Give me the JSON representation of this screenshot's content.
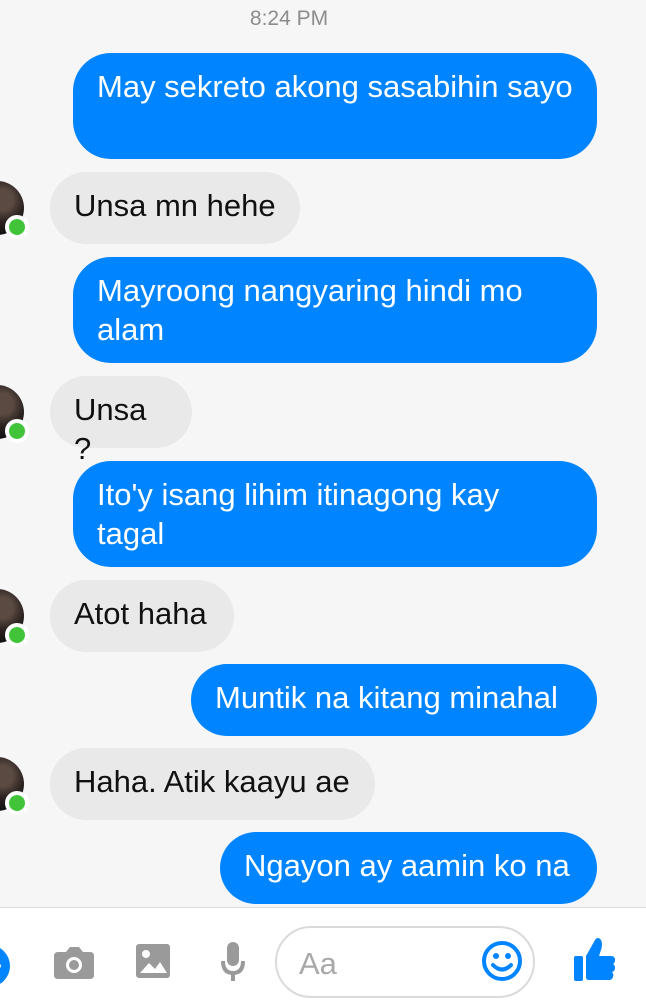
{
  "conversation": {
    "timestamp": "8:24 PM",
    "messages": [
      {
        "sender": "me",
        "text": "May sekreto akong sasabihin sayo"
      },
      {
        "sender": "contact",
        "text": "Unsa mn hehe"
      },
      {
        "sender": "me",
        "text": "Mayroong nangyaring hindi mo alam"
      },
      {
        "sender": "contact",
        "text": "Unsa ?"
      },
      {
        "sender": "me",
        "text": "Ito'y isang lihim itinagong kay tagal"
      },
      {
        "sender": "contact",
        "text": "Atot haha"
      },
      {
        "sender": "me",
        "text": "Muntik na kitang minahal"
      },
      {
        "sender": "contact",
        "text": "Haha. Atik kaayu ae"
      },
      {
        "sender": "me",
        "text": "Ngayon ay aamin ko na"
      }
    ]
  },
  "composer": {
    "placeholder": "Aa",
    "icons": [
      "add-icon",
      "camera-icon",
      "image-icon",
      "microphone-icon",
      "emoji-icon",
      "like-icon"
    ]
  },
  "colors": {
    "outgoing_bubble": "#0084ff",
    "incoming_bubble": "#e9e9e9",
    "online_indicator": "#42c43a",
    "accent": "#0084ff"
  }
}
